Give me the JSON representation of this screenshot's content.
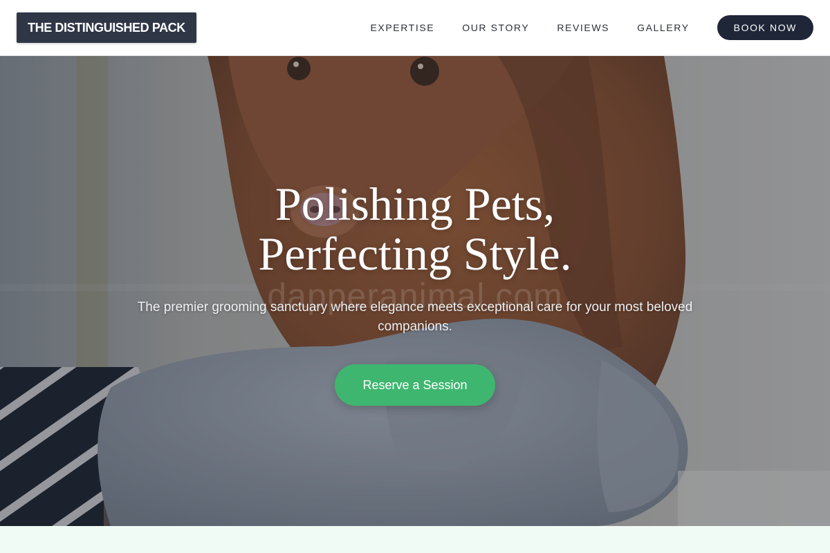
{
  "brand": {
    "name": "THE DISTINGUISHED PACK"
  },
  "nav": {
    "links": [
      "EXPERTISE",
      "OUR STORY",
      "REVIEWS",
      "GALLERY"
    ],
    "cta_label": "BOOK NOW"
  },
  "hero": {
    "title_line1": "Polishing Pets,",
    "title_line2": "Perfecting Style.",
    "subtitle": "The premier grooming sanctuary where elegance meets exceptional care for your most beloved companions.",
    "cta_label": "Reserve a Session",
    "watermark": "dapperanimal.com"
  },
  "colors": {
    "nav_background": "#ffffff",
    "logo_background": "#2f3747",
    "book_button": "#1e2638",
    "cta_green": "#3fb66f",
    "section_below": "#f1fbf5"
  }
}
